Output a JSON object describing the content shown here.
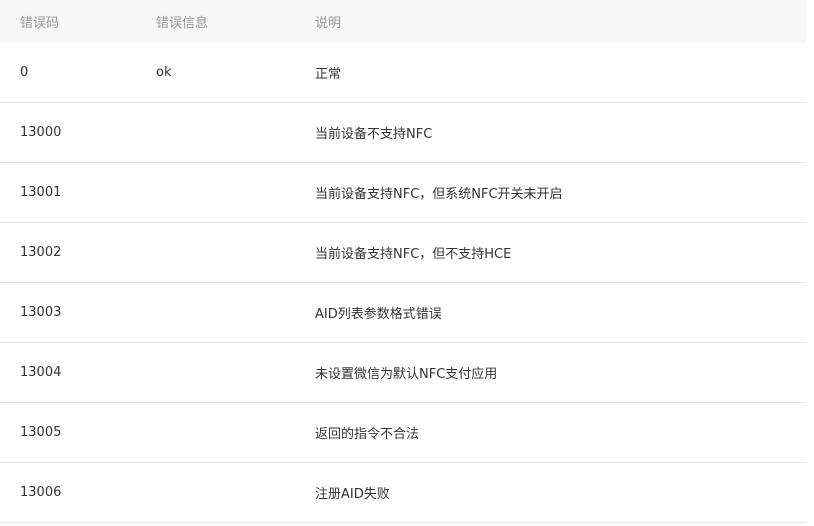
{
  "table": {
    "headers": [
      "错误码",
      "错误信息",
      "说明"
    ],
    "rows": [
      {
        "code": "0",
        "message": "ok",
        "description": "正常"
      },
      {
        "code": "13000",
        "message": "",
        "description": "当前设备不支持NFC"
      },
      {
        "code": "13001",
        "message": "",
        "description": "当前设备支持NFC，但系统NFC开关未开启"
      },
      {
        "code": "13002",
        "message": "",
        "description": "当前设备支持NFC，但不支持HCE"
      },
      {
        "code": "13003",
        "message": "",
        "description": "AID列表参数格式错误"
      },
      {
        "code": "13004",
        "message": "",
        "description": "未设置微信为默认NFC支付应用"
      },
      {
        "code": "13005",
        "message": "",
        "description": "返回的指令不合法"
      },
      {
        "code": "13006",
        "message": "",
        "description": "注册AID失败"
      }
    ]
  }
}
